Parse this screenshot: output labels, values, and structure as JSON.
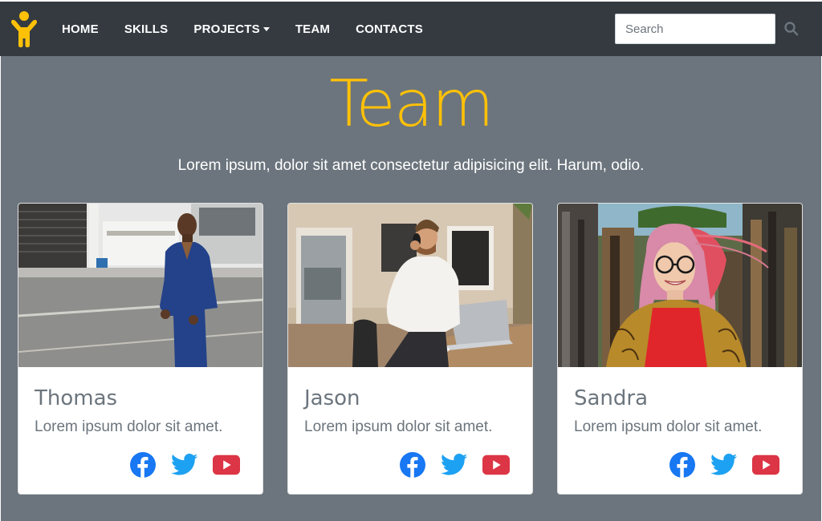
{
  "nav": {
    "items": [
      {
        "label": "HOME"
      },
      {
        "label": "SKILLS"
      },
      {
        "label": "PROJECTS",
        "has_dropdown": true
      },
      {
        "label": "TEAM"
      },
      {
        "label": "CONTACTS"
      }
    ],
    "search": {
      "placeholder": "Search",
      "value": ""
    }
  },
  "hero": {
    "title": "Team",
    "subtitle": "Lorem ipsum, dolor sit amet consectetur adipisicing elit. Harum, odio."
  },
  "team": [
    {
      "name": "Thomas",
      "description": "Lorem ipsum dolor sit amet.",
      "socials": [
        "facebook-icon",
        "twitter-icon",
        "youtube-icon"
      ]
    },
    {
      "name": "Jason",
      "description": "Lorem ipsum dolor sit amet.",
      "socials": [
        "facebook-icon",
        "twitter-icon",
        "youtube-icon"
      ]
    },
    {
      "name": "Sandra",
      "description": "Lorem ipsum dolor sit amet.",
      "socials": [
        "facebook-icon",
        "twitter-icon",
        "youtube-icon"
      ]
    }
  ],
  "colors": {
    "navbar": "#343a40",
    "background": "#6c757d",
    "accent": "#ffc107",
    "facebook": "#1877f2",
    "twitter": "#1da1f2",
    "youtube": "#dc3545"
  }
}
